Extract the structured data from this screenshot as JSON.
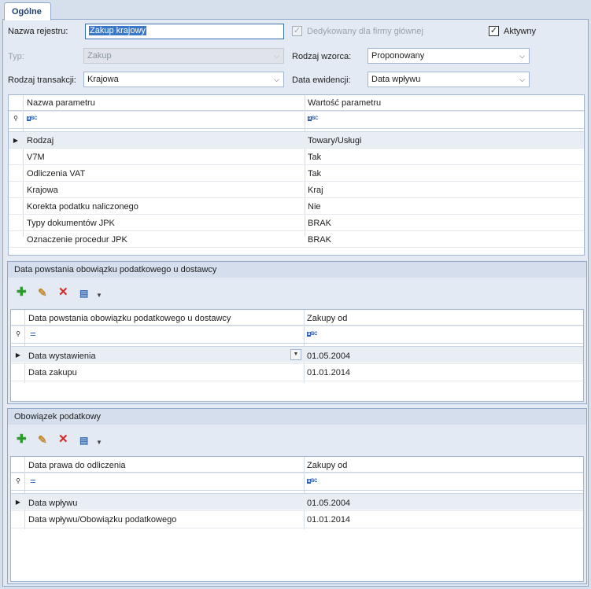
{
  "tab": {
    "label": "Ogólne"
  },
  "form": {
    "nazwa_rejestru_label": "Nazwa rejestru:",
    "nazwa_rejestru_value": "Zakup krajowy",
    "dedykowany_label": "Dedykowany dla firmy głównej",
    "dedykowany_checked": true,
    "aktywny_label": "Aktywny",
    "aktywny_checked": true,
    "typ_label": "Typ:",
    "typ_value": "Zakup",
    "rodzaj_wzorca_label": "Rodzaj wzorca:",
    "rodzaj_wzorca_value": "Proponowany",
    "rodzaj_transakcji_label": "Rodzaj transakcji:",
    "rodzaj_transakcji_value": "Krajowa",
    "data_ewidencji_label": "Data ewidencji:",
    "data_ewidencji_value": "Data wpływu"
  },
  "params_grid": {
    "col1": "Nazwa parametru",
    "col2": "Wartość parametru",
    "filter_icon": "abc-filter-icon",
    "rows": [
      {
        "name": "Rodzaj",
        "value": "Towary/Usługi"
      },
      {
        "name": "V7M",
        "value": "Tak"
      },
      {
        "name": "Odliczenia VAT",
        "value": "Tak"
      },
      {
        "name": "Krajowa",
        "value": "Kraj"
      },
      {
        "name": "Korekta podatku naliczonego",
        "value": "Nie"
      },
      {
        "name": "Typy dokumentów JPK",
        "value": "BRAK"
      },
      {
        "name": "Oznaczenie procedur JPK",
        "value": "BRAK"
      }
    ]
  },
  "group1": {
    "title": "Data powstania obowiązku podatkowego u dostawcy",
    "col1": "Data powstania obowiązku podatkowego u dostawcy",
    "col2": "Zakupy od",
    "filter_eq": "=",
    "rows": [
      {
        "name": "Data wystawienia",
        "value": "01.05.2004"
      },
      {
        "name": "Data zakupu",
        "value": "01.01.2014"
      }
    ]
  },
  "group2": {
    "title": "Obowiązek podatkowy",
    "col1": "Data prawa do odliczenia",
    "col2": "Zakupy od",
    "filter_eq": "=",
    "rows": [
      {
        "name": "Data wpływu",
        "value": "01.05.2004"
      },
      {
        "name": "Data wpływu/Obowiązku podatkowego",
        "value": "01.01.2014"
      }
    ]
  },
  "toolbar": {
    "add": "✚",
    "edit": "✎",
    "delete": "✕",
    "export": "▤",
    "dropdown": "▼"
  },
  "glyphs": {
    "check": "✓",
    "combo_arrow": "⌵",
    "row_indicator": "▶",
    "filter_pin": "⚲"
  },
  "colors": {
    "background": "#d6dfec",
    "panel": "#e3eaf4",
    "border": "#8fa7c8",
    "selection": "#3a78c8",
    "add_green": "#2f9b2f",
    "delete_red": "#d8261e"
  }
}
